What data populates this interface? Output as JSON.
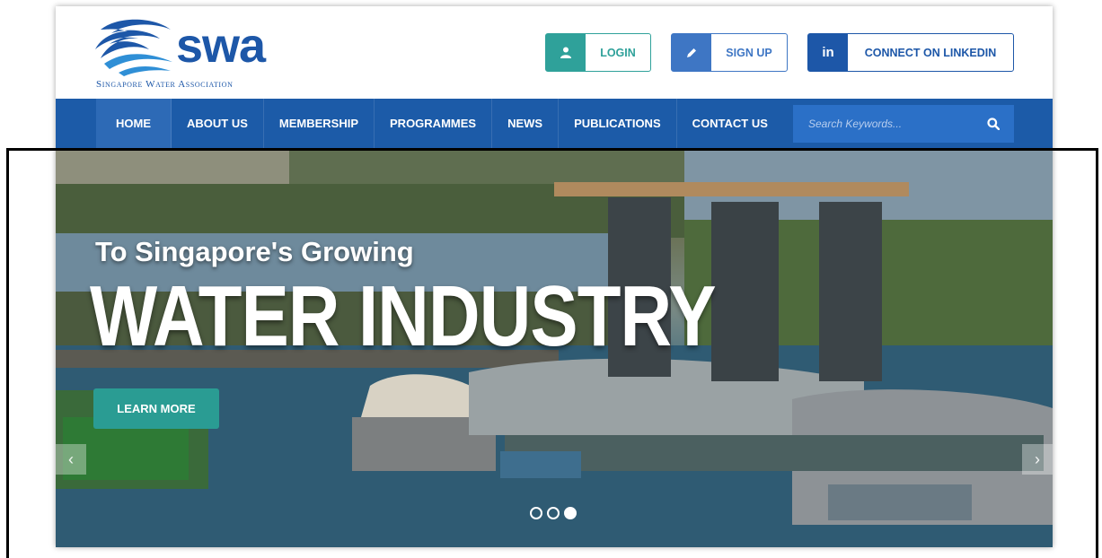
{
  "brand": {
    "logo_text": "swa",
    "tagline": "Singapore Water Association"
  },
  "header_buttons": {
    "login": {
      "label": "LOGIN",
      "icon": "user-icon"
    },
    "signup": {
      "label": "SIGN UP",
      "icon": "pencil-icon"
    },
    "linkedin": {
      "label": "CONNECT ON LINKEDIN",
      "icon": "linkedin-icon",
      "icon_text": "in"
    }
  },
  "nav": {
    "items": [
      {
        "label": "HOME",
        "active": true
      },
      {
        "label": "ABOUT US"
      },
      {
        "label": "MEMBERSHIP"
      },
      {
        "label": "PROGRAMMES"
      },
      {
        "label": "NEWS"
      },
      {
        "label": "PUBLICATIONS"
      },
      {
        "label": "CONTACT US"
      }
    ],
    "search_placeholder": "Search Keywords..."
  },
  "hero": {
    "subtitle": "To Singapore's Growing",
    "title": "WATER INDUSTRY",
    "cta_label": "LEARN MORE",
    "arrow_left": "‹",
    "arrow_right": "›",
    "slide_count": 3,
    "active_slide": 3
  },
  "colors": {
    "brand_blue": "#1d57a8",
    "nav_blue": "#1c5ba8",
    "teal": "#2fa19a",
    "signup_blue": "#3e76c4"
  }
}
